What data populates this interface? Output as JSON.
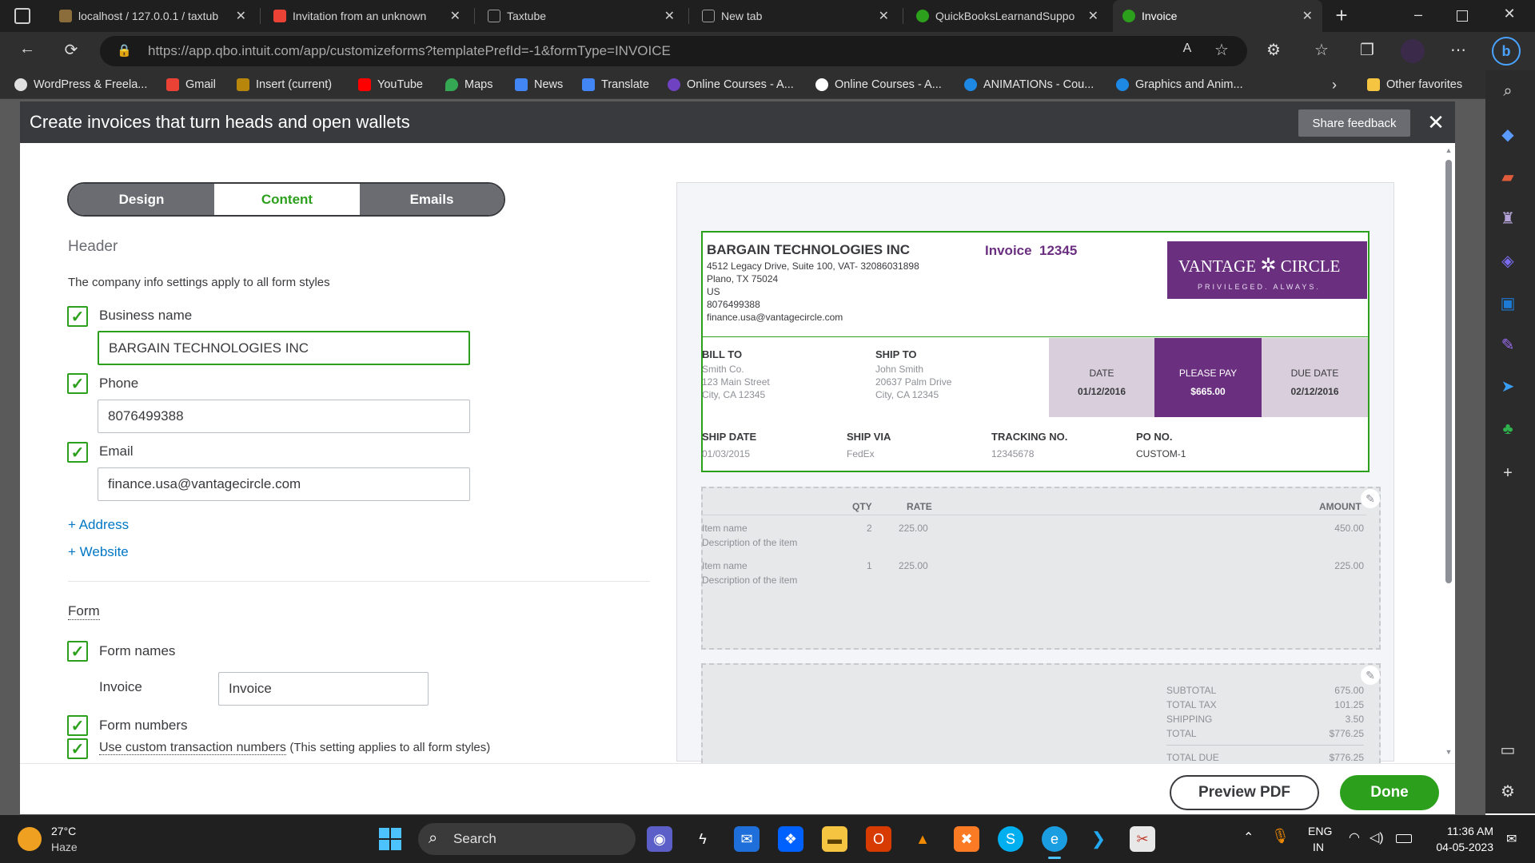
{
  "browser": {
    "tabs": [
      {
        "title": "localhost / 127.0.0.1 / taxtub",
        "color": "#8a6d3b"
      },
      {
        "title": "Invitation from an unknown",
        "color": "#ea4335"
      },
      {
        "title": "Taxtube",
        "color": "#9e9e9e"
      },
      {
        "title": "New tab",
        "color": "#9e9e9e"
      },
      {
        "title": "QuickBooksLearnandSuppo",
        "color": "#2ca01c"
      },
      {
        "title": "Invoice",
        "color": "#2ca01c"
      }
    ],
    "url": "https://app.qbo.intuit.com/app/customizeforms?templatePrefId=-1&formType=INVOICE",
    "bookmarks": [
      {
        "label": "WordPress & Freela...",
        "color": "#e0e0e0"
      },
      {
        "label": "Gmail",
        "color": "#ea4335"
      },
      {
        "label": "Insert (current)",
        "color": "#b8860b"
      },
      {
        "label": "YouTube",
        "color": "#ff0000"
      },
      {
        "label": "Maps",
        "color": "#34a853"
      },
      {
        "label": "News",
        "color": "#4285f4"
      },
      {
        "label": "Translate",
        "color": "#4285f4"
      },
      {
        "label": "Online Courses - A...",
        "color": "#6f42c1"
      },
      {
        "label": "Online Courses - A...",
        "color": "#ffffff"
      },
      {
        "label": "ANIMATIONs - Cou...",
        "color": "#1e88e5"
      },
      {
        "label": "Graphics and Anim...",
        "color": "#1e88e5"
      }
    ],
    "other_favorites": "Other favorites"
  },
  "modal": {
    "title": "Create invoices that turn heads and open wallets",
    "share_feedback": "Share feedback"
  },
  "tabs": {
    "design": "Design",
    "content": "Content",
    "emails": "Emails"
  },
  "header": {
    "section_title": "Header",
    "note": "The company info settings apply to all form styles",
    "business_name_label": "Business name",
    "business_name_value": "BARGAIN TECHNOLOGIES INC",
    "phone_label": "Phone",
    "phone_value": "8076499388",
    "email_label": "Email",
    "email_value": "finance.usa@vantagecircle.com",
    "add_address": "+ Address",
    "add_website": "+ Website"
  },
  "form": {
    "section_title": "Form",
    "form_names_label": "Form names",
    "invoice_label": "Invoice",
    "invoice_value": "Invoice",
    "form_numbers_label": "Form numbers",
    "custom_numbers_label": "Use custom transaction numbers",
    "custom_numbers_note": "(This setting applies to all form styles)"
  },
  "invoice": {
    "company": "BARGAIN TECHNOLOGIES INC",
    "address1": "4512 Legacy Drive, Suite 100, VAT- 32086031898",
    "address2": "Plano, TX 75024",
    "country": "US",
    "phone": "8076499388",
    "email": "finance.usa@vantagecircle.com",
    "title": "Invoice  12345",
    "logo_main": "VANTAGE",
    "logo_main2": "CIRCLE",
    "logo_tag": "PRIVILEGED. ALWAYS.",
    "bill_to_label": "BILL TO",
    "bill_to": [
      "Smith Co.",
      "123 Main Street",
      "City, CA 12345"
    ],
    "ship_to_label": "SHIP TO",
    "ship_to": [
      "John Smith",
      "20637 Palm Drive",
      "City, CA 12345"
    ],
    "date_label": "DATE",
    "date_value": "01/12/2016",
    "please_pay_label": "PLEASE PAY",
    "please_pay_value": "$665.00",
    "due_date_label": "DUE DATE",
    "due_date_value": "02/12/2016",
    "ship_date_label": "SHIP DATE",
    "ship_date_value": "01/03/2015",
    "ship_via_label": "SHIP VIA",
    "ship_via_value": "FedEx",
    "tracking_label": "TRACKING NO.",
    "tracking_value": "12345678",
    "po_label": "PO NO.",
    "po_value": "CUSTOM-1",
    "items_header": {
      "qty": "QTY",
      "rate": "RATE",
      "amount": "AMOUNT"
    },
    "items": [
      {
        "name": "Item name",
        "desc": "Description of the item",
        "qty": "2",
        "rate": "225.00",
        "amount": "450.00"
      },
      {
        "name": "Item name",
        "desc": "Description of the item",
        "qty": "1",
        "rate": "225.00",
        "amount": "225.00"
      }
    ],
    "totals": [
      {
        "label": "SUBTOTAL",
        "value": "675.00"
      },
      {
        "label": "TOTAL TAX",
        "value": "101.25"
      },
      {
        "label": "SHIPPING",
        "value": "3.50"
      },
      {
        "label": "TOTAL",
        "value": "$776.25"
      },
      {
        "label": "TOTAL DUE",
        "value": "$776.25"
      }
    ],
    "accent_purple": "#6b2f80",
    "panel_lilac": "#d9cfdc"
  },
  "buttons": {
    "preview_pdf": "Preview PDF",
    "done": "Done"
  },
  "taskbar": {
    "weather_temp": "27°C",
    "weather_desc": "Haze",
    "search": "Search",
    "lang1": "ENG",
    "lang2": "IN",
    "time": "11:36 AM",
    "date": "04-05-2023"
  },
  "colors": {
    "green": "#2ca01c",
    "dark": "#393a3d",
    "link": "#0077c5"
  }
}
